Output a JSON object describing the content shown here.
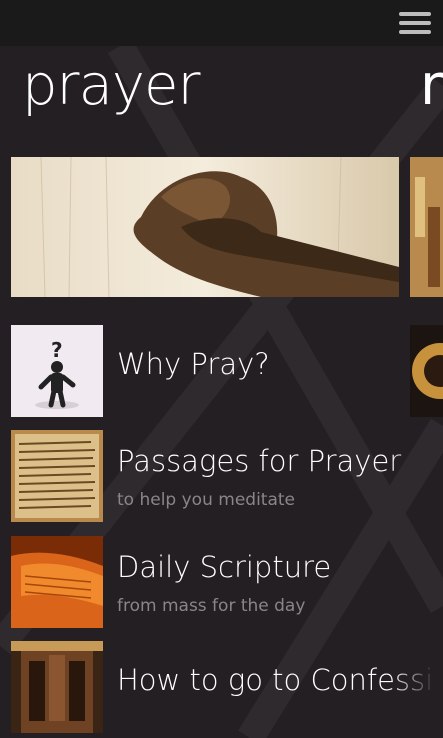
{
  "app": {
    "section_title": "prayer",
    "next_section_peek": "r"
  },
  "topbar": {
    "menu_icon": "hamburger-icon"
  },
  "items": [
    {
      "title": "Why Pray?",
      "subtitle": ""
    },
    {
      "title": "Passages for Prayer",
      "subtitle": "to help you meditate"
    },
    {
      "title": "Daily Scripture",
      "subtitle": "from mass for the day"
    },
    {
      "title": "How to go to Confession",
      "subtitle": ""
    }
  ],
  "colors": {
    "background": "#231f22",
    "topbar": "#1a1a1a",
    "subtitle": "#8a8688"
  }
}
